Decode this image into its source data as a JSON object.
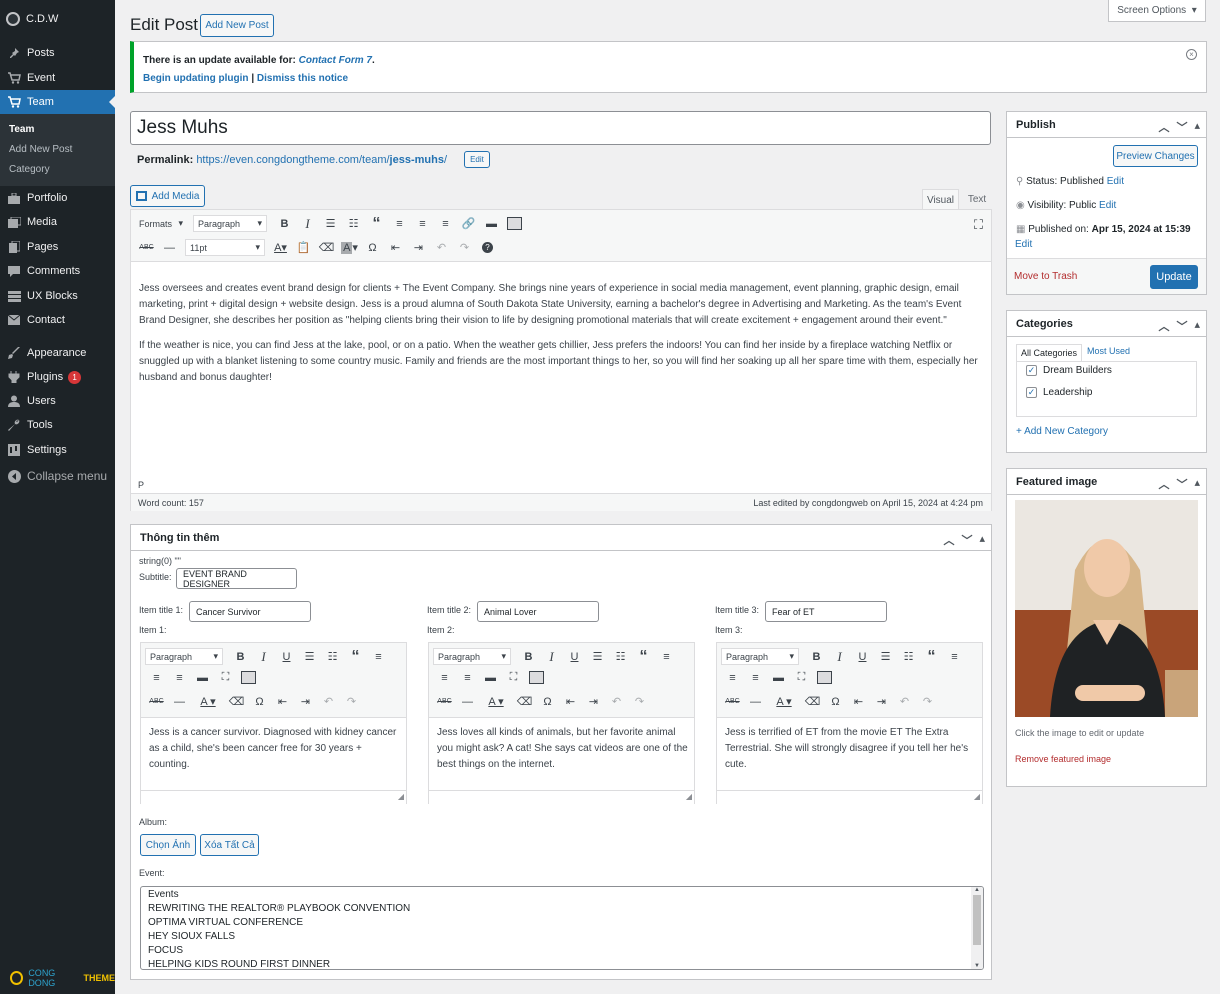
{
  "site": {
    "name": "C.D.W",
    "footer_brand_1": "CONG DONG",
    "footer_brand_2": "THEME"
  },
  "menu": [
    {
      "label": "Posts",
      "icon": "pin-icon"
    },
    {
      "label": "Event",
      "icon": "cart-icon"
    },
    {
      "label": "Team",
      "icon": "cart-icon"
    },
    {
      "label": "Portfolio",
      "icon": "portfolio-icon"
    },
    {
      "label": "Media",
      "icon": "media-icon"
    },
    {
      "label": "Pages",
      "icon": "pages-icon"
    },
    {
      "label": "Comments",
      "icon": "comments-icon"
    },
    {
      "label": "UX Blocks",
      "icon": "blocks-icon"
    },
    {
      "label": "Contact",
      "icon": "mail-icon"
    },
    {
      "label": "Appearance",
      "icon": "brush-icon"
    },
    {
      "label": "Plugins",
      "icon": "plugin-icon",
      "badge": "1"
    },
    {
      "label": "Users",
      "icon": "users-icon"
    },
    {
      "label": "Tools",
      "icon": "wrench-icon"
    },
    {
      "label": "Settings",
      "icon": "settings-icon"
    },
    {
      "label": "Collapse menu",
      "icon": "collapse-icon"
    }
  ],
  "submenu": [
    "Team",
    "Add New Post",
    "Category"
  ],
  "header": {
    "title": "Edit Post",
    "add_new": "Add New Post",
    "screen_options": "Screen Options"
  },
  "notice": {
    "text": "There is an update available for:",
    "plugin": "Contact Form 7",
    "period": ".",
    "update_link": "Begin updating plugin",
    "sep": "|",
    "dismiss_link": "Dismiss this notice"
  },
  "post": {
    "title": "Jess Muhs",
    "permalink_label": "Permalink:",
    "permalink_base": "https://even.congdongtheme.com/team/",
    "permalink_slug": "jess-muhs",
    "permalink_end": "/",
    "edit_btn": "Edit"
  },
  "editor": {
    "add_media": "Add Media",
    "tab_visual": "Visual",
    "tab_text": "Text",
    "formats": "Formats",
    "paragraph": "Paragraph",
    "font_size": "11pt",
    "paragraph1": "Jess oversees and creates event brand design for clients + The Event Company. She brings nine years of experience in social media management, event planning, graphic design, email marketing, print + digital design + website design. Jess is a proud alumna of South Dakota State University, earning a bachelor's degree in Advertising and Marketing. As the team's Event Brand Designer, she describes her position as \"helping clients bring their vision to life by designing promotional materials that will create excitement + engagement around their event.\"",
    "paragraph2": "If the weather is nice, you can find Jess at the lake, pool, or on a patio. When the weather gets chillier, Jess prefers the indoors! You can find her inside by a fireplace watching Netflix or snuggled up with a blanket listening to some country music. Family and friends are the most important things to her, so you will find her soaking up all her spare time with them, especially her husband and bonus daughter!",
    "path": "P",
    "word_count": "Word count: 157",
    "last_edited": "Last edited by congdongweb on April 15, 2024 at 4:24 pm"
  },
  "extra": {
    "title": "Thông tin thêm",
    "debug": "string(0) \"\"",
    "subtitle_label": "Subtitle:",
    "subtitle_value": "EVENT BRAND DESIGNER",
    "items": [
      {
        "title_label": "Item title 1:",
        "title_value": "Cancer Survivor",
        "item_label": "Item 1:",
        "text": "Jess is a cancer survivor. Diagnosed with kidney cancer as a child, she's been cancer free for 30 years + counting."
      },
      {
        "title_label": "Item title 2:",
        "title_value": "Animal Lover",
        "item_label": "Item 2:",
        "text": "Jess loves all kinds of animals, but her favorite animal you might ask? A cat! She says cat videos are one of the best things on the internet."
      },
      {
        "title_label": "Item title 3:",
        "title_value": "Fear of ET",
        "item_label": "Item 3:",
        "text": "Jess is terrified of ET from the movie ET The Extra Terrestrial. She will strongly disagree if you tell her he's cute."
      }
    ],
    "album_label": "Album:",
    "choose_btn": "Chọn Ảnh",
    "clear_btn": "Xóa Tất Cả",
    "event_label": "Event:",
    "events": [
      "Events",
      "REWRITING THE REALTOR® PLAYBOOK CONVENTION",
      "OPTIMA VIRTUAL CONFERENCE",
      "HEY SIOUX FALLS",
      "FOCUS",
      "HELPING KIDS ROUND FIRST DINNER"
    ]
  },
  "publish": {
    "title": "Publish",
    "preview": "Preview Changes",
    "status_label": "Status:",
    "status": "Published",
    "visibility_label": "Visibility:",
    "visibility": "Public",
    "edit": "Edit",
    "published_label": "Published on:",
    "published_date": "Apr 15, 2024 at 15:39",
    "trash": "Move to Trash",
    "update": "Update"
  },
  "categories": {
    "title": "Categories",
    "tab_all": "All Categories",
    "tab_used": "Most Used",
    "items": [
      {
        "label": "Dream Builders",
        "checked": true
      },
      {
        "label": "Leadership",
        "checked": true
      }
    ],
    "add_new": "+ Add New Category"
  },
  "featured": {
    "title": "Featured image",
    "hint": "Click the image to edit or update",
    "remove": "Remove featured image"
  },
  "colors": {
    "accent": "#2271b1",
    "sidebar": "#1d2327",
    "notice_border": "#00a32a",
    "danger": "#b32d2e"
  }
}
